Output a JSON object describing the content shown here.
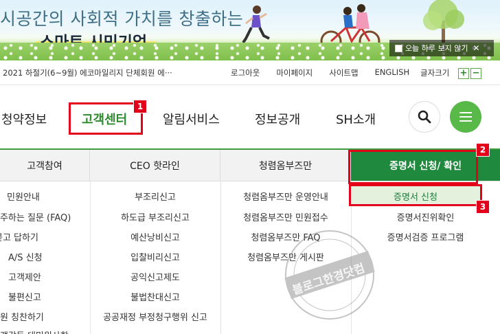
{
  "banner": {
    "headline": "시공간의 사회적 가치를 창출하는",
    "headline2": "스마트 시민기업",
    "dont_show_today": "오늘 하루 보지 않기",
    "close_symbol": "✕"
  },
  "util_bar": {
    "notice": "2021 하절기(6~9월) 에코마일리지 단체회원 에···",
    "links": [
      "로그아웃",
      "마이페이지",
      "사이트맵",
      "ENGLISH"
    ],
    "font_size_label": "글자크기",
    "font_plus": "+",
    "font_minus": "−"
  },
  "nav": {
    "items": [
      "청약정보",
      "고객센터",
      "알림서비스",
      "정보공개",
      "SH소개"
    ],
    "active_index": 1
  },
  "mega_menu": {
    "columns": [
      {
        "heading": "고객참여",
        "items": [
          "민원안내",
          "자주하는 질문 (FAQ)",
          "묻고 답하기",
          "A/S 신청",
          "고객제안",
          "불편신고",
          "직원 칭찬하기",
          "고객감동 대민원사항"
        ]
      },
      {
        "heading": "CEO 핫라인",
        "items": [
          "부조리신고",
          "하도급 부조리신고",
          "예산낭비신고",
          "입찰비리신고",
          "공익신고제도",
          "불법찬대신고",
          "공공재정 부정청구행위 신고"
        ]
      },
      {
        "heading": "청렴옴부즈만",
        "items": [
          "청렴옴부즈만 운영안내",
          "청렴옴부즈만 민원접수",
          "청렴옴부즈만 FAQ",
          "청렴옴부즈만 게시판"
        ]
      },
      {
        "heading": "증명서 신청/ 확인",
        "items": [
          "증명서 신청",
          "증명서진위확인",
          "증명서검증 프로그램"
        ]
      }
    ]
  },
  "annotations": {
    "badge1": "1",
    "badge2": "2",
    "badge3": "3"
  },
  "watermark": {
    "text": "블로그한경닷컴"
  },
  "colors": {
    "accent_green": "#1f8a3e",
    "nav_active_green": "#2e8b2e",
    "annotation_red": "#e3001b",
    "menu_button_green": "#58b848"
  }
}
